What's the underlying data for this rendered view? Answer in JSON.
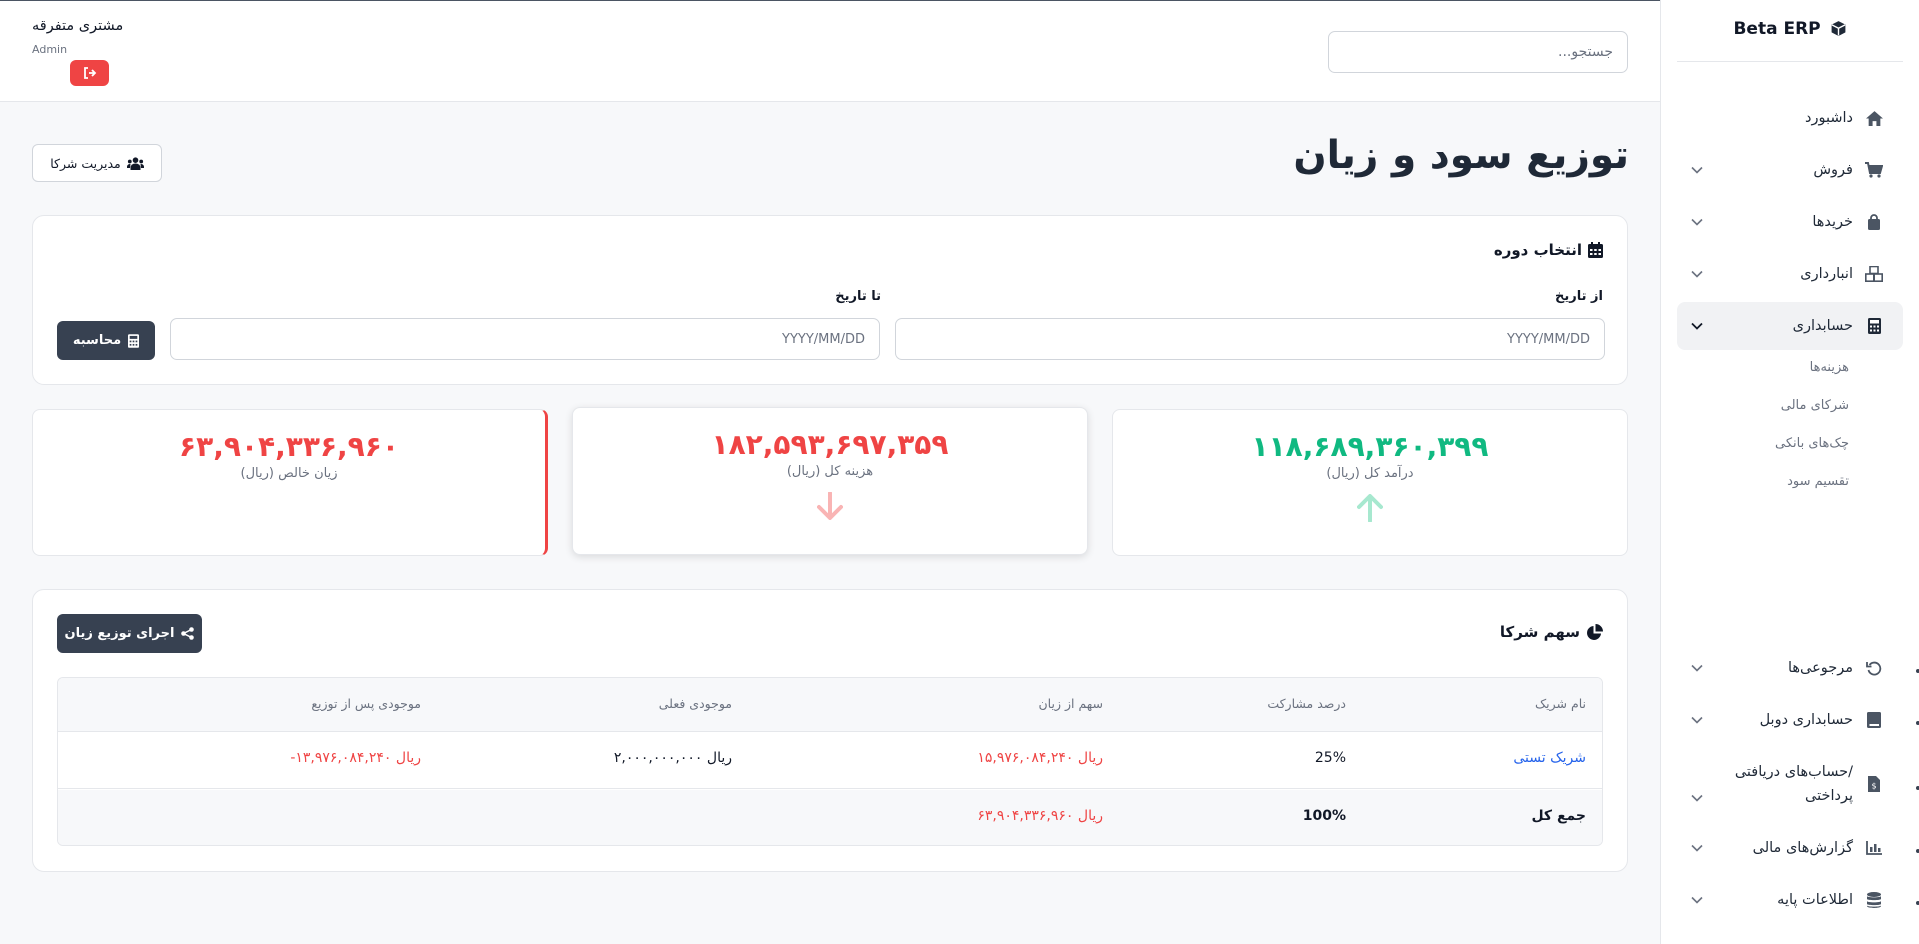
{
  "app": {
    "brand": "Beta ERP",
    "brand_icon": "cube-icon"
  },
  "sidebar": {
    "items": [
      {
        "label": "داشبورد",
        "icon": "home-icon",
        "has_chevron": false
      },
      {
        "label": "فروش",
        "icon": "cart-icon",
        "has_chevron": true
      },
      {
        "label": "خریدها",
        "icon": "bag-icon",
        "has_chevron": true
      },
      {
        "label": "انبارداری",
        "icon": "boxes-icon",
        "has_chevron": true
      },
      {
        "label": "حسابداری",
        "icon": "calculator-icon",
        "has_chevron": true,
        "active": true
      },
      {
        "label": "مرجوعی‌ها",
        "icon": "undo-icon",
        "has_chevron": true
      },
      {
        "label": "حسابداری دوبل",
        "icon": "book-icon",
        "has_chevron": true
      },
      {
        "label": "حساب‌های دریافتی/\nپرداختی",
        "icon": "invoice-icon",
        "has_chevron": true
      },
      {
        "label": "گزارش‌های مالی",
        "icon": "chart-icon",
        "has_chevron": true
      },
      {
        "label": "اطلاعات پایه",
        "icon": "database-icon",
        "has_chevron": true
      }
    ],
    "subitems": [
      "هزینه‌ها",
      "شرکای مالی",
      "چک‌های بانکی",
      "تقسیم سود"
    ]
  },
  "topbar": {
    "search_placeholder": "جستجو...",
    "user_name": "مشتری متفرقه",
    "user_role": "Admin",
    "logout_icon": "sign-out-icon"
  },
  "page": {
    "title": "توزیع سود و زیان",
    "partners_button": "مدیریت شرکا"
  },
  "period": {
    "title": "انتخاب دوره",
    "from_label": "از تاریخ",
    "to_label": "تا تاریخ",
    "date_placeholder": "YYYY/MM/DD",
    "calc_button": "محاسبه"
  },
  "stats": {
    "income": {
      "value": "۱۱۸,۶۸۹,۳۶۰,۳۹۹",
      "label": "درآمد کل (ریال)",
      "color": "#10b981"
    },
    "expense": {
      "value": "۱۸۲,۵۹۳,۶۹۷,۳۵۹",
      "label": "هزینه کل (ریال)",
      "color": "#ef4444"
    },
    "net": {
      "value": "۶۳,۹۰۴,۳۳۶,۹۶۰",
      "label": "زیان خالص (ریال)",
      "color": "#ef4444"
    }
  },
  "shares": {
    "title": "سهم شرکا",
    "run_button": "اجرای توزیع زیان",
    "headers": [
      "نام شریک",
      "درصد مشارکت",
      "سهم از زیان",
      "موجودی فعلی",
      "موجودی پس از توزیع"
    ],
    "rows": [
      {
        "name": "شریک تستی",
        "percent": "25%",
        "share": "۱۵,۹۷۶,۰۸۴,۲۴۰ ریال",
        "balance": "۲,۰۰۰,۰۰۰,۰۰۰ ریال",
        "after": "-۱۳,۹۷۶,۰۸۴,۲۴۰ ریال"
      }
    ],
    "total": {
      "label": "جمع کل",
      "percent": "100%",
      "share": "۶۳,۹۰۴,۳۳۶,۹۶۰ ریال"
    }
  }
}
